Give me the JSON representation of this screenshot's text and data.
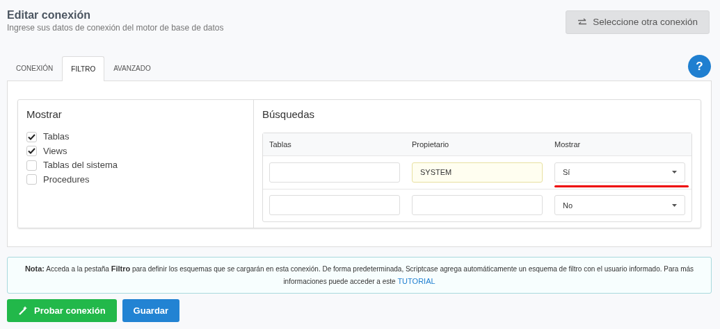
{
  "header": {
    "title": "Editar conexión",
    "subtitle": "Ingrese sus datos de conexión del motor de base de datos",
    "switch_button": "Seleccione otra conexión"
  },
  "tabs": [
    {
      "label": "CONEXIÓN",
      "selected": false
    },
    {
      "label": "FILTRO",
      "selected": true
    },
    {
      "label": "AVANZADO",
      "selected": false
    }
  ],
  "help_button": "?",
  "show_panel": {
    "title": "Mostrar",
    "options": [
      {
        "label": "Tablas",
        "checked": true
      },
      {
        "label": "Views",
        "checked": true
      },
      {
        "label": "Tablas del sistema",
        "checked": false
      },
      {
        "label": "Procedures",
        "checked": false
      }
    ]
  },
  "search_panel": {
    "title": "Búsquedas",
    "columns": [
      "Tablas",
      "Propietario",
      "Mostrar"
    ],
    "rows": [
      {
        "tables": "",
        "owner": "SYSTEM",
        "owner_highlighted": true,
        "show": "Sí",
        "show_underlined": true
      },
      {
        "tables": "",
        "owner": "",
        "owner_highlighted": false,
        "show": "No",
        "show_underlined": false
      }
    ]
  },
  "note": {
    "text": "**Nota:** Acceda a la pestaña **Filtro** para definir los esquemas que se cargarán en esta conexión. De forma predeterminada, Scriptcase agrega automáticamente un esquema de filtro con el usuario informado. Para más informaciones puede acceder a este",
    "link": "TUTORIAL"
  },
  "buttons": [
    {
      "label": "Probar conexión",
      "kind": "test"
    },
    {
      "label": "Guardar",
      "kind": "save"
    }
  ]
}
